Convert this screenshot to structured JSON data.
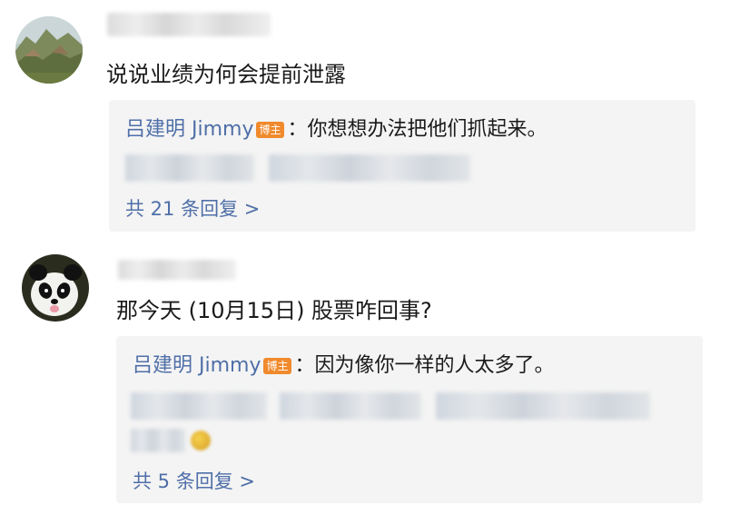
{
  "comments": [
    {
      "text": "说说业绩为何会提前泄露",
      "reply": {
        "author": "吕建明 Jimmy",
        "badge": "博主",
        "separator": "：",
        "text": "你想想办法把他们抓起来。"
      },
      "more_replies": "共 21 条回复 >"
    },
    {
      "text": "那今天 (10月15日) 股票咋回事?",
      "reply": {
        "author": "吕建明 Jimmy",
        "badge": "博主",
        "separator": "：",
        "text": "因为像你一样的人太多了。"
      },
      "more_replies": "共 5 条回复 >"
    }
  ],
  "colors": {
    "link_blue": "#4f6fa8",
    "badge_orange": "#f08a2c",
    "reply_bg": "#f4f4f4"
  },
  "icons": [
    "avatar-landscape",
    "avatar-panda",
    "blogger-badge",
    "laughing-emoji-icon"
  ]
}
